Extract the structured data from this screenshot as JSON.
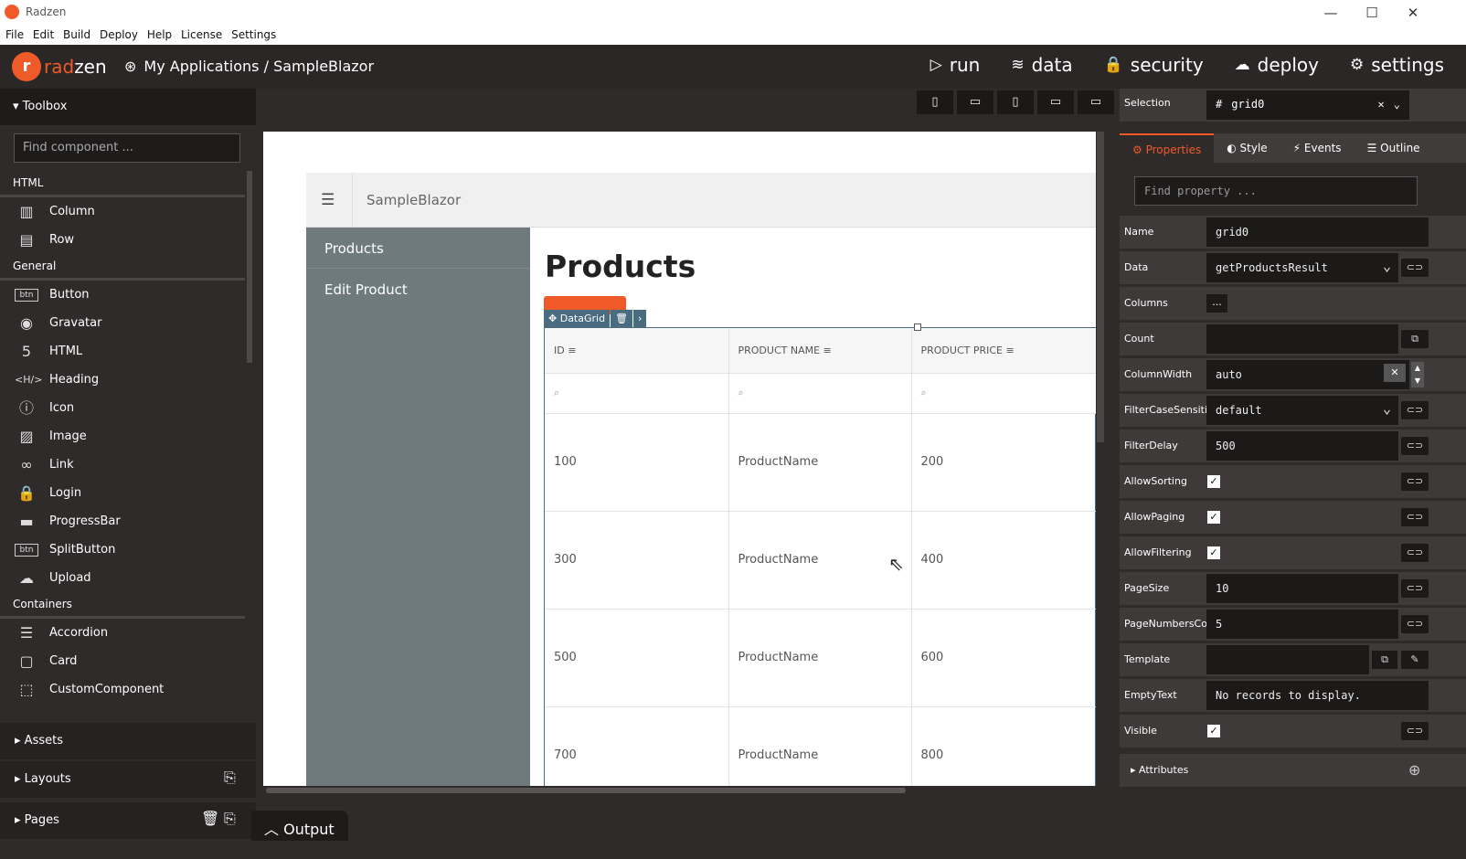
{
  "window": {
    "title": "Radzen",
    "min": "—",
    "max": "☐",
    "close": "✕"
  },
  "menu": [
    "File",
    "Edit",
    "Build",
    "Deploy",
    "Help",
    "License",
    "Settings"
  ],
  "topbar": {
    "logo_mark": "r",
    "logo_rad": "rad",
    "logo_zen": "zen",
    "breadcrumb": "My Applications / SampleBlazor",
    "nav": [
      {
        "label": "run",
        "icon": "▷"
      },
      {
        "label": "data",
        "icon": "≋"
      },
      {
        "label": "security",
        "icon": "🔒"
      },
      {
        "label": "deploy",
        "icon": "☁"
      },
      {
        "label": "settings",
        "icon": "⚙"
      }
    ]
  },
  "toolbox": {
    "title": "Toolbox",
    "search_placeholder": "Find component ...",
    "sections": {
      "html": "HTML",
      "general": "General",
      "containers": "Containers"
    },
    "html_items": [
      {
        "label": "Column",
        "icon": "▥"
      },
      {
        "label": "Row",
        "icon": "▤"
      }
    ],
    "general_items": [
      {
        "label": "Button",
        "icon": "btn"
      },
      {
        "label": "Gravatar",
        "icon": "◉"
      },
      {
        "label": "HTML",
        "icon": "5"
      },
      {
        "label": "Heading",
        "icon": "<H/>"
      },
      {
        "label": "Icon",
        "icon": "ⓘ"
      },
      {
        "label": "Image",
        "icon": "▨"
      },
      {
        "label": "Link",
        "icon": "∞"
      },
      {
        "label": "Login",
        "icon": "🔒"
      },
      {
        "label": "ProgressBar",
        "icon": "▬"
      },
      {
        "label": "SplitButton",
        "icon": "btn"
      },
      {
        "label": "Upload",
        "icon": "☁"
      }
    ],
    "container_items": [
      {
        "label": "Accordion",
        "icon": "☰"
      },
      {
        "label": "Card",
        "icon": "▢"
      },
      {
        "label": "CustomComponent",
        "icon": "⬚"
      }
    ],
    "assets": "Assets",
    "layouts": "Layouts",
    "pages": "Pages"
  },
  "output": {
    "label": "Output"
  },
  "canvas": {
    "app_title": "SampleBlazor",
    "sidebar": [
      "Products",
      "Edit Product"
    ],
    "page_title": "Products",
    "datagrid_tag": "DataGrid",
    "columns": [
      "ID",
      "PRODUCT NAME",
      "PRODUCT PRICE"
    ],
    "rows": [
      [
        "100",
        "ProductName",
        "200"
      ],
      [
        "300",
        "ProductName",
        "400"
      ],
      [
        "500",
        "ProductName",
        "600"
      ],
      [
        "700",
        "ProductName",
        "800"
      ]
    ]
  },
  "props": {
    "selection_label": "Selection",
    "selection_value": "grid0",
    "tabs": [
      "Properties",
      "Style",
      "Events",
      "Outline"
    ],
    "find_placeholder": "Find property ...",
    "rows": {
      "name": {
        "label": "Name",
        "value": "grid0"
      },
      "data": {
        "label": "Data",
        "value": "getProductsResult"
      },
      "columns": {
        "label": "Columns",
        "value": "..."
      },
      "count": {
        "label": "Count",
        "value": ""
      },
      "columnwidth": {
        "label": "ColumnWidth",
        "value": "auto"
      },
      "filtercase": {
        "label": "FilterCaseSensiti...",
        "value": "default"
      },
      "filterdelay": {
        "label": "FilterDelay",
        "value": "500"
      },
      "allowsorting": {
        "label": "AllowSorting",
        "value": "✓"
      },
      "allowpaging": {
        "label": "AllowPaging",
        "value": "✓"
      },
      "allowfiltering": {
        "label": "AllowFiltering",
        "value": "✓"
      },
      "pagesize": {
        "label": "PageSize",
        "value": "10"
      },
      "pagenumbers": {
        "label": "PageNumbersCo...",
        "value": "5"
      },
      "template": {
        "label": "Template",
        "value": ""
      },
      "emptytext": {
        "label": "EmptyText",
        "value": "No records to display."
      },
      "visible": {
        "label": "Visible",
        "value": "✓"
      }
    },
    "attributes": "Attributes"
  }
}
